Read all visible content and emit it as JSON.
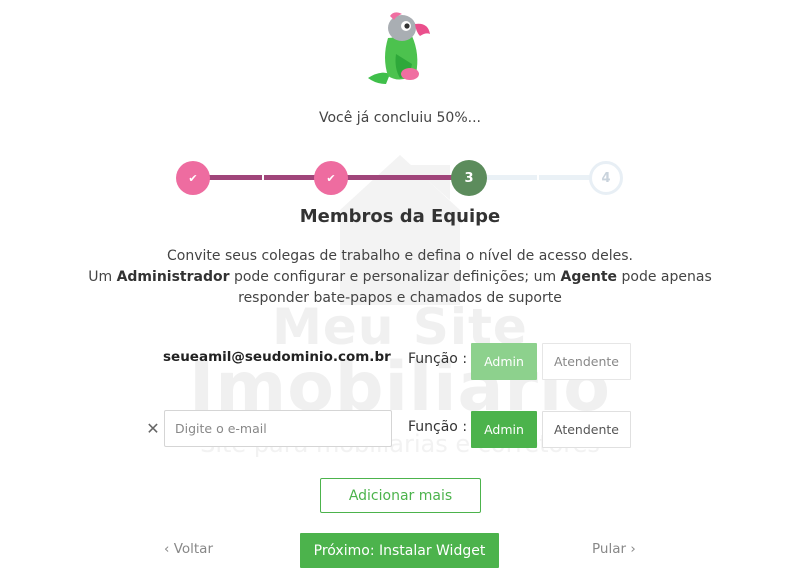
{
  "watermark": {
    "line1": "Meu Site",
    "line2": "Imobiliario",
    "line3": "Site para mobiliarias e corretores"
  },
  "logo": {
    "icon": "parrot-icon"
  },
  "progress_text": "Você já concluiu 50%...",
  "stepper": {
    "steps": [
      {
        "state": "done",
        "icon": "check-icon",
        "label": "✔"
      },
      {
        "state": "done",
        "icon": "check-icon",
        "label": "✔"
      },
      {
        "state": "current",
        "label": "3"
      },
      {
        "state": "todo",
        "label": "4"
      }
    ],
    "colors": {
      "done": "#ee6ca0",
      "current": "#5c8c5c",
      "todo": "#e8eff5",
      "track_done": "#a0457a"
    }
  },
  "section_title": "Membros da Equipe",
  "description": {
    "line1": "Convite seus colegas de trabalho e defina o nível de acesso deles.",
    "line2_pre": "Um ",
    "line2_admin": "Administrador",
    "line2_mid": " pode configurar e personalizar definições; um ",
    "line2_agent": "Agente",
    "line2_post": " pode apenas",
    "line3": "responder bate-papos e chamados de suporte"
  },
  "members": [
    {
      "email": "seueamil@seudominio.com.br",
      "role_label": "Função :",
      "admin_label": "Admin",
      "agent_label": "Atendente"
    },
    {
      "email_placeholder": "Digite o e-mail",
      "email_value": "",
      "role_label": "Função :",
      "admin_label": "Admin",
      "agent_label": "Atendente",
      "remove_icon": "close-icon"
    }
  ],
  "add_more_label": "Adicionar mais",
  "footer": {
    "back_label": "‹ Voltar",
    "next_label": "Próximo: Instalar Widget",
    "skip_label": "Pular ›"
  },
  "accent_color": "#4cb34c"
}
